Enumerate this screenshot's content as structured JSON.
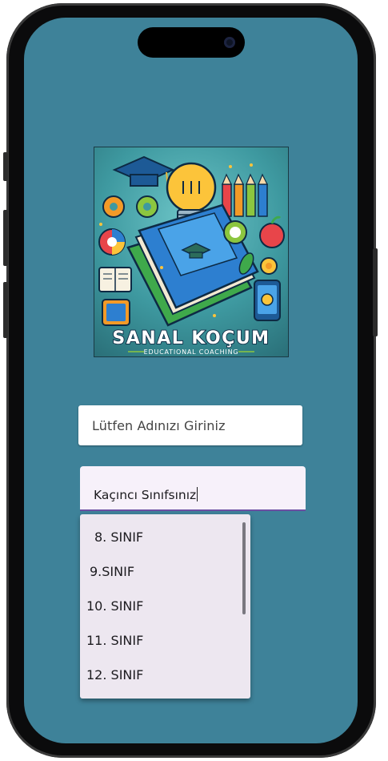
{
  "logo": {
    "title": "SANAL KOÇUM",
    "subtitle": "EDUCATIONAL COACHING"
  },
  "name_field": {
    "placeholder": "Lütfen Adınızı Giriniz"
  },
  "class_field": {
    "value": "Kaçıncı Sınıfsınız"
  },
  "class_options": [
    "8. SINIF",
    "9.SINIF",
    "10. SINIF",
    "11. SINIF",
    "12. SINIF"
  ],
  "colors": {
    "background": "#3e8299",
    "field_underline": "#6b4ea2",
    "dropdown_bg": "#ede7f0"
  }
}
